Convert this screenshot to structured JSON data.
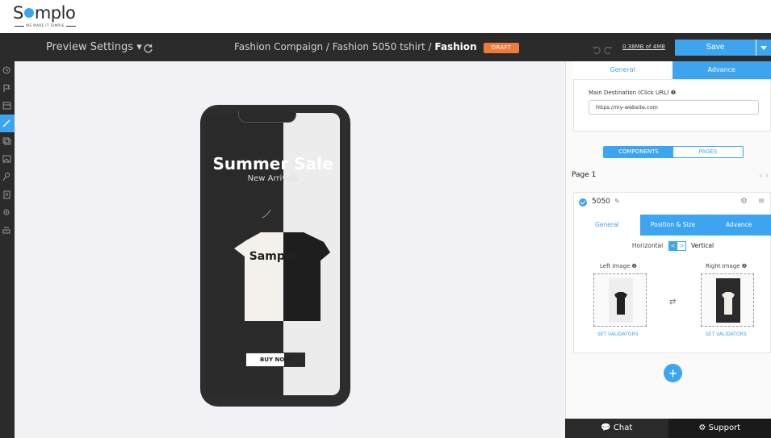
{
  "brand": {
    "name": "Samplo",
    "tagline": "WE MAKE IT SIMPLE"
  },
  "toolbar": {
    "preview_settings": "Preview Settings ▾",
    "breadcrumb_path": "Fashion Compaign / Fashion 5050 tshirt /",
    "breadcrumb_current": "Fashion Camp",
    "draft_badge": "DRAFT",
    "storage": "0.38MB of 4MB",
    "save_label": "Save"
  },
  "left_rail": {
    "items": [
      "history-icon",
      "flag-icon",
      "layout-icon",
      "pen-icon",
      "layers-icon",
      "image-icon",
      "pin-icon",
      "clipboard-icon",
      "settings-icon",
      "inbox-icon"
    ],
    "active_index": 3
  },
  "preview": {
    "title": "Summer Sale",
    "subtitle": "New Arrivals",
    "shirt_brand": "Samplo",
    "buy_button": "BUY NOW"
  },
  "panel": {
    "top_tabs": [
      "General",
      "Advance"
    ],
    "destination_label": "Main Destination (Click URL) ❷",
    "destination_value": "https://my-website.com",
    "segment_tabs": [
      "COMPONENTS",
      "PAGES"
    ],
    "page_label": "Page 1",
    "component": {
      "name": "5050",
      "tabs": [
        "General",
        "Position & Size",
        "Advance"
      ],
      "horizontal_label": "Horizontal",
      "vertical_label": "Vertical",
      "left_image_label": "Left Image ❷",
      "right_image_label": "Right Image ❷",
      "set_validators": "SET VALIDATORS"
    }
  },
  "footer": {
    "chat": "Chat",
    "support": "Support"
  },
  "colors": {
    "accent": "#3da5ef",
    "topbar": "#2b2b2b",
    "draft": "#ef7b3a"
  }
}
